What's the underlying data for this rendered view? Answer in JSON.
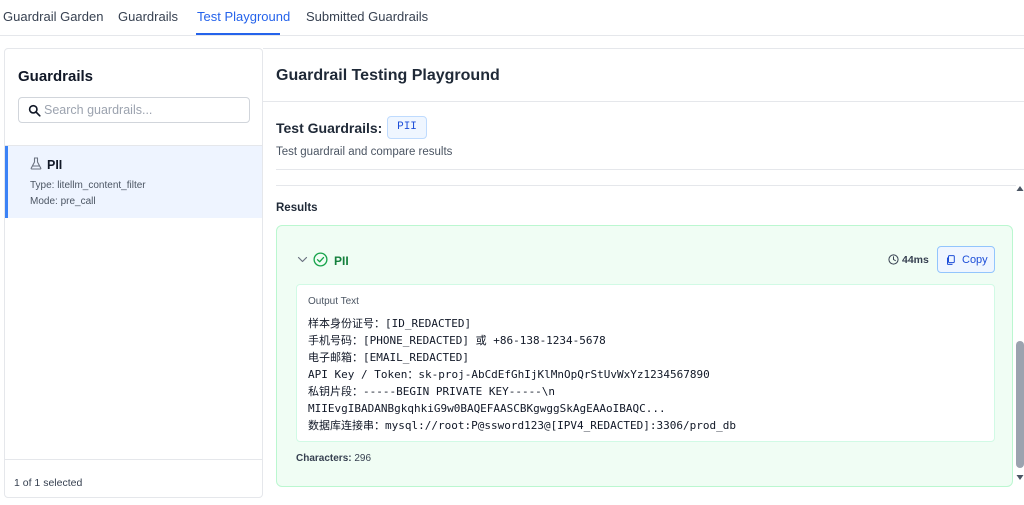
{
  "top_tabs": [
    {
      "label": "Guardrail Garden",
      "active": false
    },
    {
      "label": "Guardrails",
      "active": false
    },
    {
      "label": "Test Playground",
      "active": true
    },
    {
      "label": "Submitted Guardrails",
      "active": false
    }
  ],
  "sidebar": {
    "title": "Guardrails",
    "search_placeholder": "Search guardrails...",
    "items": [
      {
        "icon": "flask-icon",
        "name": "PII",
        "type_line": "Type: litellm_content_filter",
        "mode_line": "Mode: pre_call",
        "selected": true
      }
    ],
    "footer": "1 of 1 selected"
  },
  "main": {
    "title": "Guardrail Testing Playground",
    "test_heading": "Test Guardrails:",
    "chip": "PII",
    "subtitle": "Test guardrail and compare results",
    "results_label": "Results",
    "result": {
      "status_icon": "check-circle-icon",
      "name": "PII",
      "latency": "44ms",
      "copy_label": "Copy",
      "output_label": "Output Text",
      "output_lines": [
        "样本身份证号：[ID_REDACTED]",
        "手机号码：[PHONE_REDACTED] 或 +86-138-1234-5678",
        "电子邮箱：[EMAIL_REDACTED]",
        "API Key / Token：sk-proj-AbCdEfGhIjKlMnOpQrStUvWxYz1234567890",
        "私钥片段：-----BEGIN PRIVATE KEY-----\\n",
        "MIIEvgIBADANBgkqhkiG9w0BAQEFAASCBKgwggSkAgEAAoIBAQC...",
        "数据库连接串：mysql://root:P@ssword123@[IPV4_REDACTED]:3306/prod_db"
      ],
      "characters_label": "Characters:",
      "characters_value": "296"
    }
  },
  "colors": {
    "accent": "#2563eb",
    "success": "#16a34a",
    "success_bg": "#f0fdf4",
    "selected_bg": "#eef4ff"
  }
}
